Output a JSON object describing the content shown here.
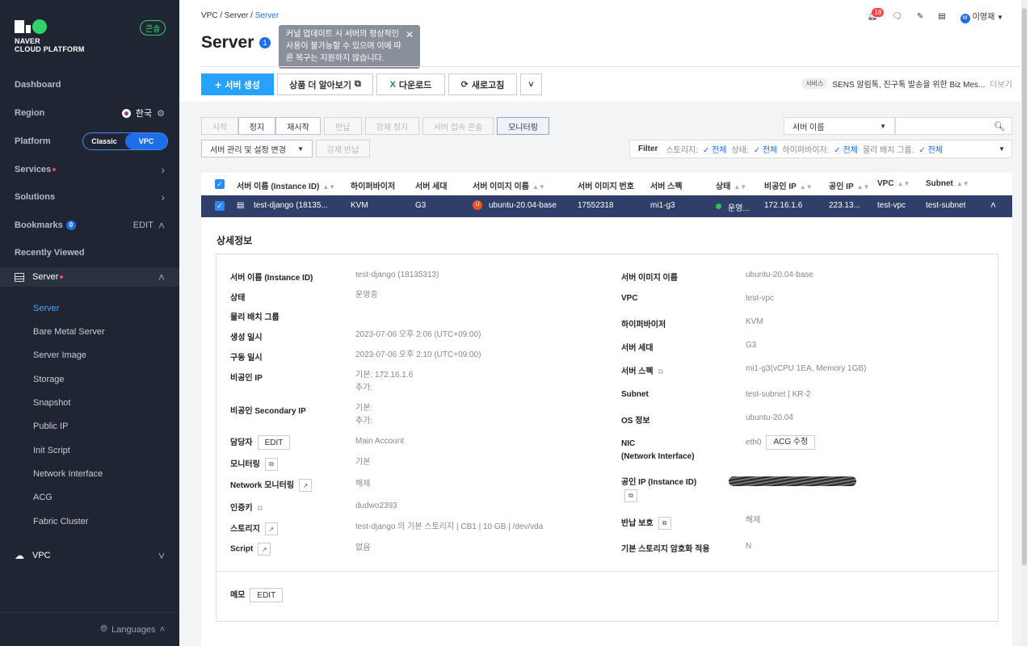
{
  "sidebar": {
    "logo_line1": "NAVER",
    "logo_line2": "CLOUD PLATFORM",
    "console_badge": "콘솔",
    "dashboard": "Dashboard",
    "region_label": "Region",
    "region_value": "한국",
    "platform_label": "Platform",
    "platform_classic": "Classic",
    "platform_vpc": "VPC",
    "services": "Services",
    "solutions": "Solutions",
    "bookmarks": "Bookmarks",
    "bookmarks_count": "0",
    "bookmarks_edit": "EDIT",
    "recently_viewed": "Recently Viewed",
    "server_section": "Server",
    "server_items": [
      "Server",
      "Bare Metal Server",
      "Server Image",
      "Storage",
      "Snapshot",
      "Public IP",
      "Init Script",
      "Network Interface",
      "ACG",
      "Fabric Cluster"
    ],
    "vpc_section": "VPC",
    "languages": "Languages"
  },
  "header": {
    "breadcrumb": [
      "VPC",
      "Server",
      "Server"
    ],
    "notification_count": "18",
    "user_initial": "M",
    "user_name": "이영재",
    "page_title": "Server",
    "info_count": "1",
    "tooltip_text": "커널 업데이트 시 서버의 정상적인 사용이 불가능할 수 있으며 이에 따른 복구는 지원하지 않습니다."
  },
  "toolbar": {
    "create": "서버 생성",
    "learn_more": "상품 더 알아보기",
    "download": "다운로드",
    "refresh": "새로고침",
    "service_tag": "서비스",
    "service_text": "SENS 알림톡, 친구톡 발송을 위한 Biz Mes...",
    "service_more": "더보기"
  },
  "actions": {
    "start": "시작",
    "stop": "정지",
    "restart": "재시작",
    "return": "반납",
    "force_stop": "강제 정지",
    "console": "서버 접속 콘솔",
    "monitoring": "모니터링",
    "manage": "서버 관리 및 설정 변경",
    "force_return": "강제 반납"
  },
  "search": {
    "select_value": "서버 이름"
  },
  "filter": {
    "label": "Filter",
    "storage_key": "스토리지:",
    "storage_val": "전체",
    "status_key": "상태:",
    "status_val": "전체",
    "hypervisor_key": "하이퍼바이저:",
    "hypervisor_val": "전체",
    "placement_key": "물리 배치 그룹:",
    "placement_val": "전체"
  },
  "table": {
    "headers": [
      "서버 이름 (Instance ID)",
      "하이퍼바이저",
      "서버 세대",
      "서버 이미지 이름",
      "서버 이미지 번호",
      "서버 스펙",
      "상태",
      "비공인 IP",
      "공인 IP",
      "VPC",
      "Subnet"
    ],
    "row": [
      "test-django (18135...",
      "KVM",
      "G3",
      "ubuntu-20.04-base",
      "17552318",
      "mi1-g3",
      "운영...",
      "172.16.1.6",
      "223.13...",
      "test-vpc",
      "test-subnet"
    ]
  },
  "detail": {
    "title": "상세정보",
    "left_labels": [
      "서버 이름 (Instance ID)",
      "상태",
      "물리 배치 그룹",
      "생성 일시",
      "구동 일시",
      "비공인 IP",
      "비공인 Secondary IP",
      "담당자",
      "모니터링",
      "Network 모니터링",
      "인증키",
      "스토리지",
      "Script"
    ],
    "left_values": [
      "test-django (18135313)",
      "운영중",
      "",
      "2023-07-06 오후 2:06 (UTC+09:00)",
      "2023-07-06 오후 2:10 (UTC+09:00)",
      "기본: 172.16.1.6",
      "",
      "Main Account",
      "기본",
      "해제",
      "dudwo2393",
      "test-django 의 기본 스토리지 | CB1 | 10 GB | /dev/vda",
      "없음"
    ],
    "private_ip_extra": "추가:",
    "secondary_basic": "기본:",
    "secondary_extra": "추가:",
    "edit": "EDIT",
    "right_labels": [
      "서버 이미지 이름",
      "VPC",
      "하이퍼바이저",
      "서버 세대",
      "서버 스펙",
      "Subnet",
      "OS 정보",
      "NIC",
      "(Network Interface)",
      "공인 IP (Instance ID)",
      "반납 보호",
      "기본 스토리지 암호화 적용"
    ],
    "right_values": [
      "ubuntu-20.04-base",
      "test-vpc",
      "KVM",
      "G3",
      "mi1-g3(vCPU 1EA, Memory 1GB)",
      "test-subnet | KR-2",
      "ubuntu-20.04",
      "eth0",
      "해제",
      "N"
    ],
    "acg_edit": "ACG 수정",
    "memo_label": "메모"
  }
}
